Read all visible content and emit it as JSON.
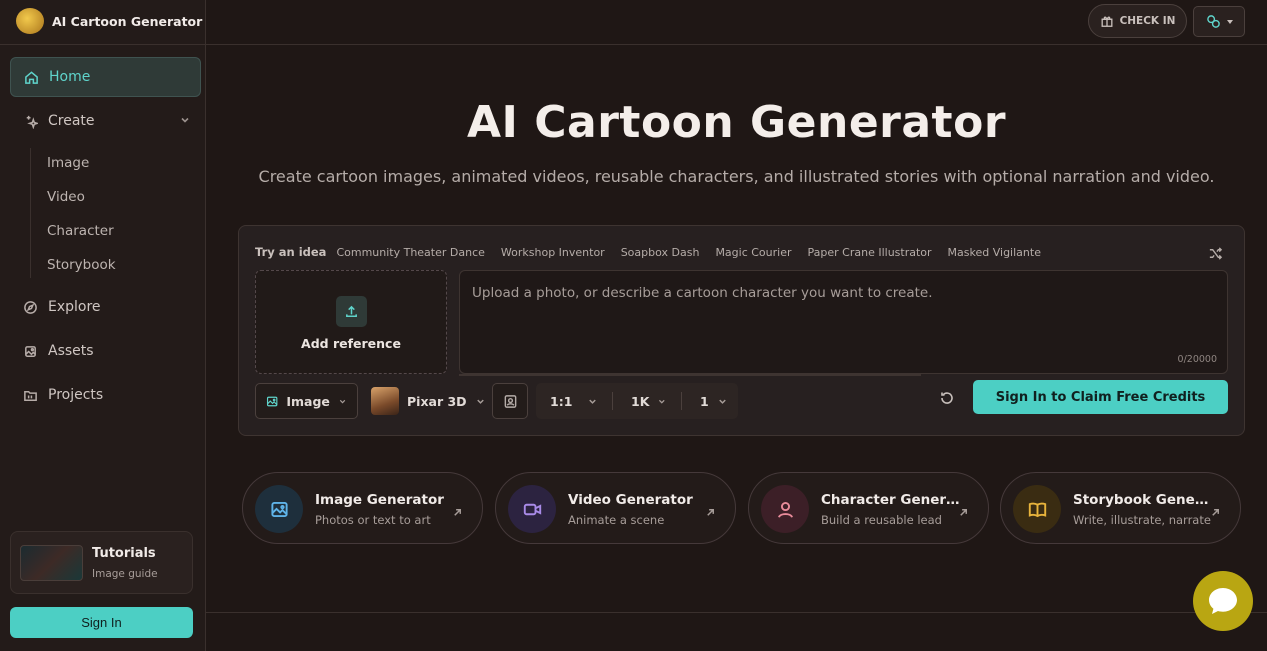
{
  "brand": {
    "name": "AI Cartoon Generator"
  },
  "sidebar": {
    "home": "Home",
    "create": "Create",
    "create_items": [
      "Image",
      "Video",
      "Character",
      "Storybook"
    ],
    "explore": "Explore",
    "assets": "Assets",
    "projects": "Projects",
    "tutorials": {
      "title": "Tutorials",
      "subtitle": "Image guide"
    },
    "sign_in": "Sign In"
  },
  "topbar": {
    "check_in": "CHECK IN"
  },
  "hero": {
    "title": "AI Cartoon Generator",
    "subtitle": "Create cartoon images, animated videos, reusable characters, and illustrated stories with optional narration and video."
  },
  "composer": {
    "ideas_label": "Try an idea",
    "ideas": [
      "Community Theater Dance",
      "Workshop Inventor",
      "Soapbox Dash",
      "Magic Courier",
      "Paper Crane Illustrator",
      "Masked Vigilante"
    ],
    "add_reference": "Add reference",
    "prompt_placeholder": "Upload a photo, or describe a cartoon character you want to create.",
    "char_count": "0/20000",
    "mode": "Image",
    "style": "Pixar 3D",
    "aspect": "1:1",
    "resolution": "1K",
    "quantity": "1",
    "claim_button": "Sign In to Claim Free Credits"
  },
  "cards": [
    {
      "title": "Image Generator",
      "subtitle": "Photos or text to art",
      "color": "#5fb3e8"
    },
    {
      "title": "Video Generator",
      "subtitle": "Animate a scene",
      "color": "#a98be8"
    },
    {
      "title": "Character Generator",
      "subtitle": "Build a reusable lead",
      "color": "#e88b9a"
    },
    {
      "title": "Storybook Generator",
      "subtitle": "Write, illustrate, narrate",
      "color": "#e8b43c"
    }
  ]
}
